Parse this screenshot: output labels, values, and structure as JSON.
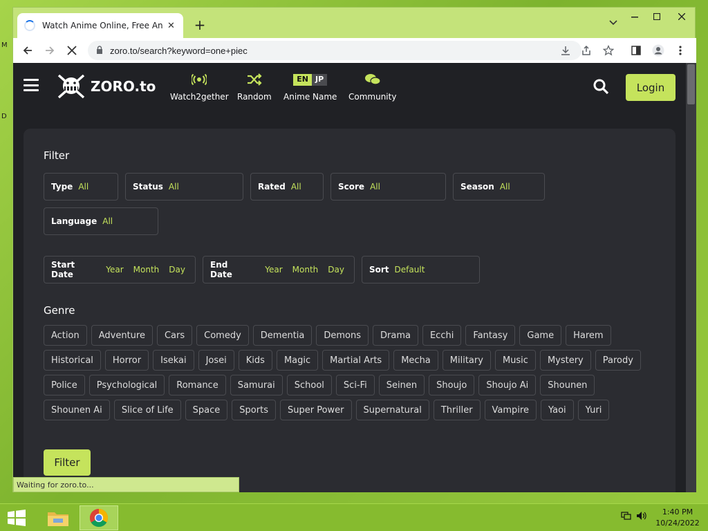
{
  "desktop": {
    "letters": [
      "M",
      "D"
    ]
  },
  "browser": {
    "tab_title": "Watch Anime Online, Free Anime",
    "url": "zoro.to/search?keyword=one+piec",
    "status": "Waiting for zoro.to..."
  },
  "site": {
    "logo_text": "ZORO.to",
    "nav": [
      {
        "label": "Watch2gether",
        "icon": "broadcast-icon"
      },
      {
        "label": "Random",
        "icon": "shuffle-icon"
      },
      {
        "label": "Anime Name",
        "icon": "language-toggle"
      },
      {
        "label": "Community",
        "icon": "chat-icon"
      }
    ],
    "lang_en": "EN",
    "lang_jp": "JP",
    "login_label": "Login"
  },
  "filter": {
    "title": "Filter",
    "type": {
      "label": "Type",
      "value": "All"
    },
    "status": {
      "label": "Status",
      "value": "All"
    },
    "rated": {
      "label": "Rated",
      "value": "All"
    },
    "score": {
      "label": "Score",
      "value": "All"
    },
    "season": {
      "label": "Season",
      "value": "All"
    },
    "language": {
      "label": "Language",
      "value": "All"
    },
    "start_date": {
      "label": "Start Date",
      "year": "Year",
      "month": "Month",
      "day": "Day"
    },
    "end_date": {
      "label": "End Date",
      "year": "Year",
      "month": "Month",
      "day": "Day"
    },
    "sort": {
      "label": "Sort",
      "value": "Default"
    },
    "button_label": "Filter"
  },
  "genre": {
    "title": "Genre",
    "items": [
      "Action",
      "Adventure",
      "Cars",
      "Comedy",
      "Dementia",
      "Demons",
      "Drama",
      "Ecchi",
      "Fantasy",
      "Game",
      "Harem",
      "Historical",
      "Horror",
      "Isekai",
      "Josei",
      "Kids",
      "Magic",
      "Martial Arts",
      "Mecha",
      "Military",
      "Music",
      "Mystery",
      "Parody",
      "Police",
      "Psychological",
      "Romance",
      "Samurai",
      "School",
      "Sci-Fi",
      "Seinen",
      "Shoujo",
      "Shoujo Ai",
      "Shounen",
      "Shounen Ai",
      "Slice of Life",
      "Space",
      "Sports",
      "Super Power",
      "Supernatural",
      "Thriller",
      "Vampire",
      "Yaoi",
      "Yuri"
    ]
  },
  "taskbar": {
    "time": "1:40 PM",
    "date": "10/24/2022"
  },
  "colors": {
    "accent": "#c5e35c",
    "page_bg": "#202125",
    "panel_bg": "#2b2c31"
  }
}
